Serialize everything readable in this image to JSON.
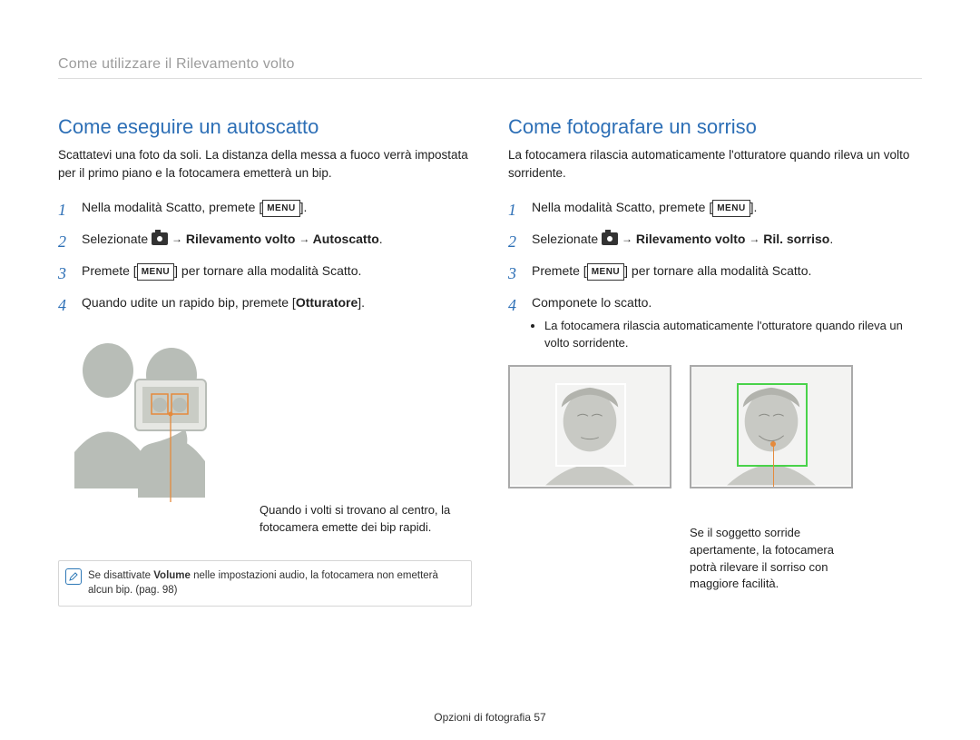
{
  "breadcrumb": "Come utilizzare il Rilevamento volto",
  "left": {
    "title": "Come eseguire un autoscatto",
    "intro": "Scattatevi una foto da soli. La distanza della messa a fuoco verrà impostata per il primo piano e la fotocamera emetterà un bip.",
    "steps": {
      "s1_a": "Nella modalità Scatto, premete [",
      "s1_b": "].",
      "s2_a": "Selezionate ",
      "s2_b": " Rilevamento volto ",
      "s2_c": " Autoscatto",
      "s2_d": ".",
      "s3_a": "Premete [",
      "s3_b": "] per tornare alla modalità Scatto.",
      "s4_a": "Quando udite un rapido bip, premete [",
      "s4_b": "Otturatore",
      "s4_c": "]."
    },
    "menu_label": "MENU",
    "illus_caption": "Quando i volti si trovano al centro, la fotocamera emette dei bip rapidi.",
    "note_a": "Se disattivate ",
    "note_b": "Volume",
    "note_c": " nelle impostazioni audio, la fotocamera non emetterà alcun bip. (pag. 98)"
  },
  "right": {
    "title": "Come fotografare un sorriso",
    "intro": "La fotocamera rilascia automaticamente l'otturatore quando rileva un volto sorridente.",
    "steps": {
      "s1_a": "Nella modalità Scatto, premete [",
      "s1_b": "].",
      "s2_a": "Selezionate ",
      "s2_b": " Rilevamento volto ",
      "s2_c": " Ril. sorriso",
      "s2_d": ".",
      "s3_a": "Premete [",
      "s3_b": "] per tornare alla modalità Scatto.",
      "s4_a": "Componete lo scatto.",
      "s4_bullet": "La fotocamera rilascia automaticamente l'otturatore quando rileva un volto sorridente."
    },
    "menu_label": "MENU",
    "smile_caption": "Se il soggetto sorride apertamente, la fotocamera potrà rilevare il sorriso con maggiore facilità."
  },
  "arrow": "→",
  "footer_a": "Opzioni di fotografia  ",
  "footer_b": "57"
}
